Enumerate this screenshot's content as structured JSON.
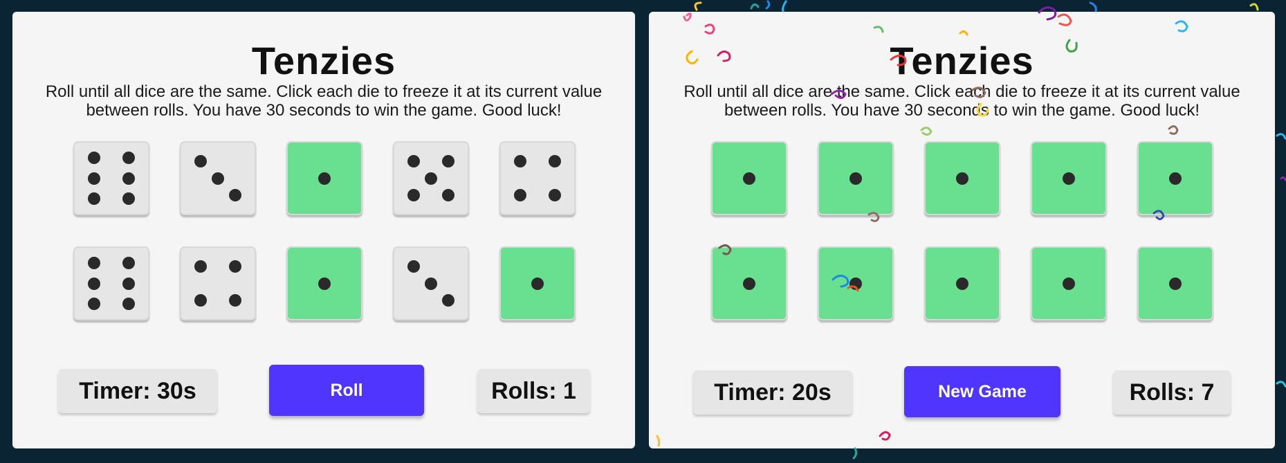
{
  "colors": {
    "page_bg": "#0b2434",
    "card_bg": "#f5f5f5",
    "die": "#e6e6e6",
    "die_held": "#68e090",
    "button": "#5035ff"
  },
  "left_game": {
    "title": "Tenzies",
    "instructions": "Roll until all dice are the same. Click each die to freeze it at its current value between rolls. You have 30 seconds to win the game. Good luck!",
    "dice": [
      {
        "value": 6,
        "held": false
      },
      {
        "value": 3,
        "held": false
      },
      {
        "value": 1,
        "held": true
      },
      {
        "value": 5,
        "held": false
      },
      {
        "value": 4,
        "held": false
      },
      {
        "value": 6,
        "held": false
      },
      {
        "value": 4,
        "held": false
      },
      {
        "value": 1,
        "held": true
      },
      {
        "value": 3,
        "held": false
      },
      {
        "value": 1,
        "held": true
      }
    ],
    "timer": "Timer: 30s",
    "button_label": "Roll",
    "rolls": "Rolls: 1"
  },
  "right_game": {
    "title": "Tenzies",
    "instructions": "Roll until all dice are the same. Click each die to freeze it at its current value between rolls. You have 30 seconds to win the game. Good luck!",
    "dice": [
      {
        "value": 1,
        "held": true
      },
      {
        "value": 1,
        "held": true
      },
      {
        "value": 1,
        "held": true
      },
      {
        "value": 1,
        "held": true
      },
      {
        "value": 1,
        "held": true
      },
      {
        "value": 1,
        "held": true
      },
      {
        "value": 1,
        "held": true
      },
      {
        "value": 1,
        "held": true
      },
      {
        "value": 1,
        "held": true
      },
      {
        "value": 1,
        "held": true
      }
    ],
    "timer": "Timer: 20s",
    "button_label": "New Game",
    "rolls": "Rolls: 7",
    "confetti": "confetti-swirls"
  }
}
